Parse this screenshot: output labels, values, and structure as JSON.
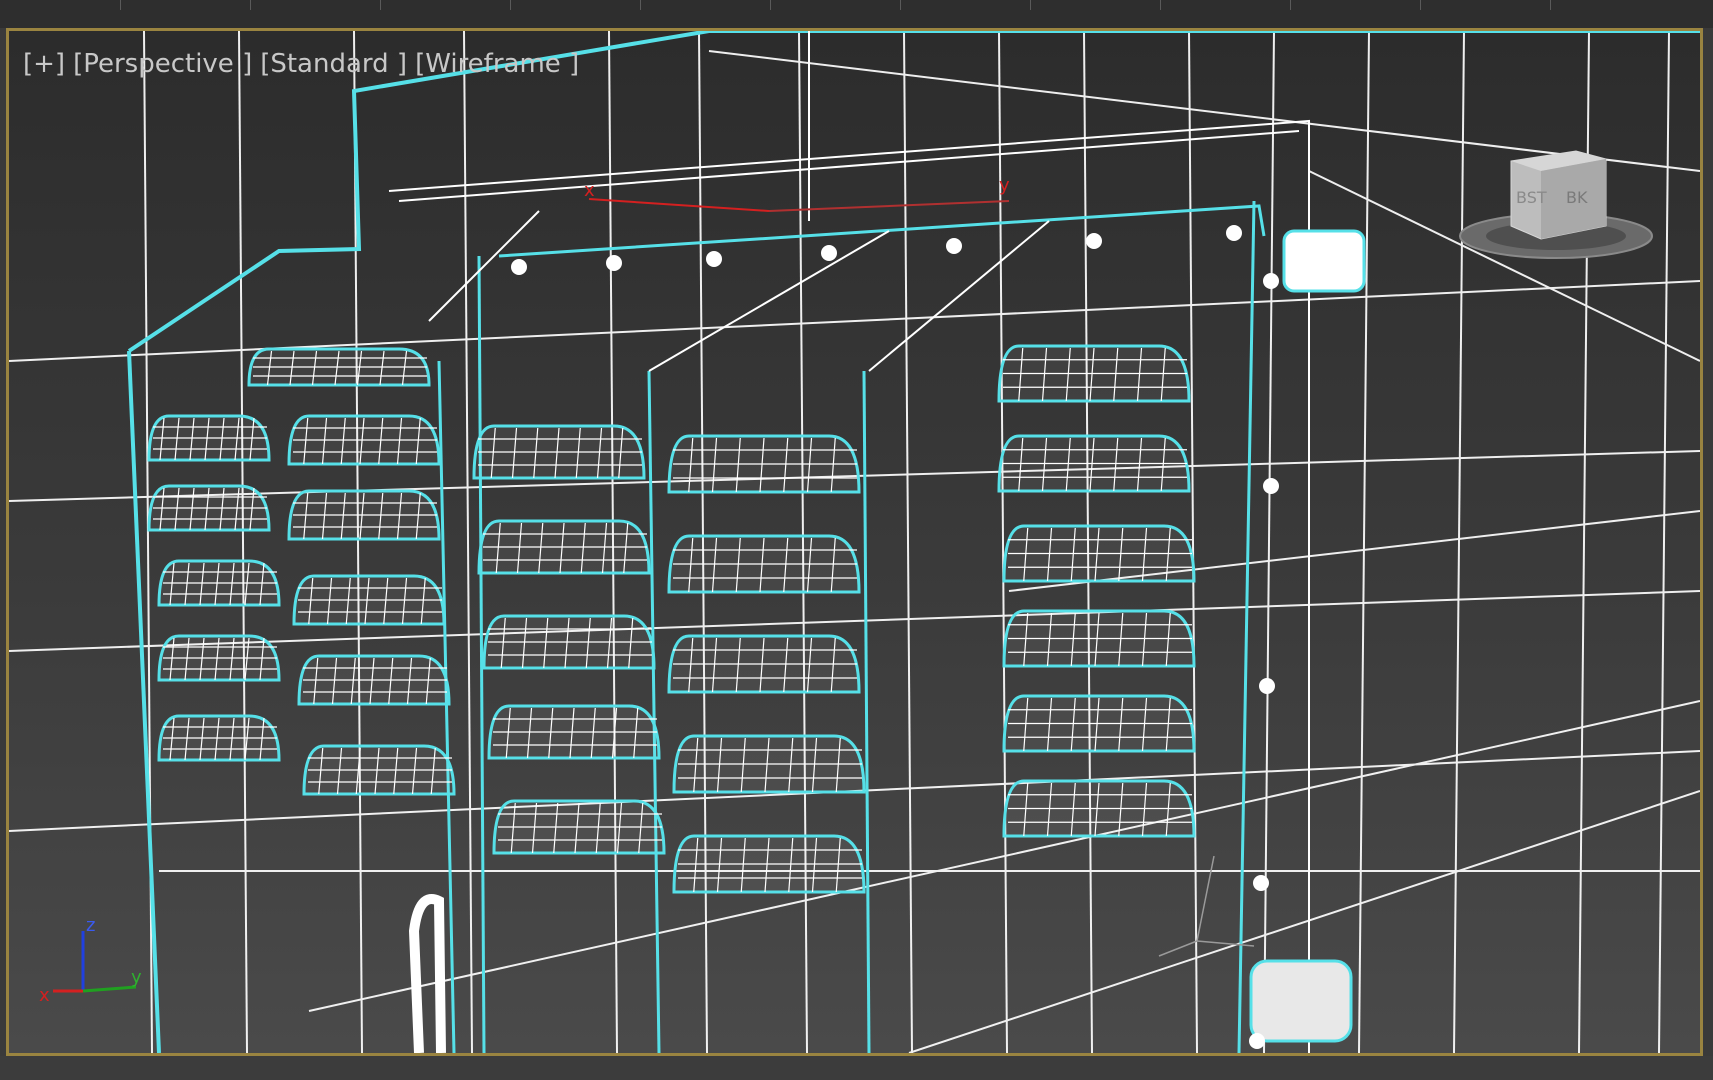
{
  "viewport": {
    "labels": [
      "[+]",
      "[Perspective ]",
      "[Standard ]",
      "[Wireframe ]"
    ]
  },
  "viewcube": {
    "face_left": "BST",
    "face_right": "ΒΚ"
  },
  "axis_tripod": {
    "z": "z",
    "x": "x",
    "y": "y"
  },
  "gizmo": {
    "x": "x",
    "y": "y"
  },
  "colors": {
    "selection": "#56e0e8",
    "wire": "#ffffff",
    "frame": "#9a8440",
    "axis_x": "#d42020",
    "axis_y": "#20a020",
    "axis_z": "#2040e0"
  }
}
